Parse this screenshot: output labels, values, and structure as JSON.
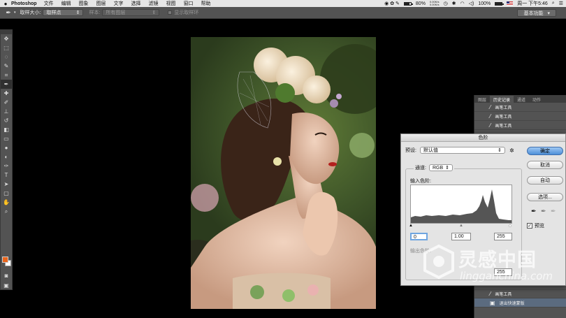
{
  "menubar": {
    "app_name": "Photoshop",
    "items": [
      "文件",
      "编辑",
      "图象",
      "图层",
      "文字",
      "选择",
      "滤镜",
      "视图",
      "窗口",
      "帮助"
    ],
    "net_up": "0.00K/s",
    "net_down": "0.00K/s",
    "battery_small": "80%",
    "battery_main": "100%",
    "clock": "周一 下午5:46"
  },
  "options": {
    "sample_size_label": "取样大小:",
    "sample_size_value": "取样点",
    "sample_label": "样本:",
    "sample_value": "所有图层",
    "show_ring_label": "显示取样环",
    "workspace": "基本功能"
  },
  "toolbox": {
    "tools": [
      "move-tool",
      "marquee-tool",
      "lasso-tool",
      "quick-select-tool",
      "crop-tool",
      "eyedropper-tool",
      "healing-brush-tool",
      "brush-tool",
      "clone-stamp-tool",
      "history-brush-tool",
      "eraser-tool",
      "gradient-tool",
      "blur-tool",
      "dodge-tool",
      "pen-tool",
      "type-tool",
      "path-select-tool",
      "shape-tool",
      "hand-tool",
      "zoom-tool"
    ],
    "foreground_color": "#e8651d",
    "background_color": "#ffffff"
  },
  "panel": {
    "tabs": [
      "图层",
      "历史记录",
      "通道",
      "动作"
    ],
    "active_tab": "历史记录",
    "history": [
      "画笔工具",
      "画笔工具",
      "画笔工具"
    ],
    "history_bottom": [
      "画笔工具",
      "退出快速蒙版"
    ]
  },
  "levels": {
    "title": "色阶",
    "preset_label": "预设:",
    "preset_value": "默认值",
    "channel_label": "通道:",
    "channel_value": "RGB",
    "input_label": "输入色阶:",
    "input_black": "0",
    "input_gamma": "1.00",
    "input_white": "255",
    "output_label": "输出色阶:",
    "output_white": "255",
    "buttons": {
      "ok": "确定",
      "cancel": "取消",
      "auto": "自动",
      "options": "选项..."
    },
    "preview_label": "预览",
    "preview_checked": true
  },
  "watermark": {
    "cn": "灵感中国",
    "en": "lingganchina.com"
  }
}
